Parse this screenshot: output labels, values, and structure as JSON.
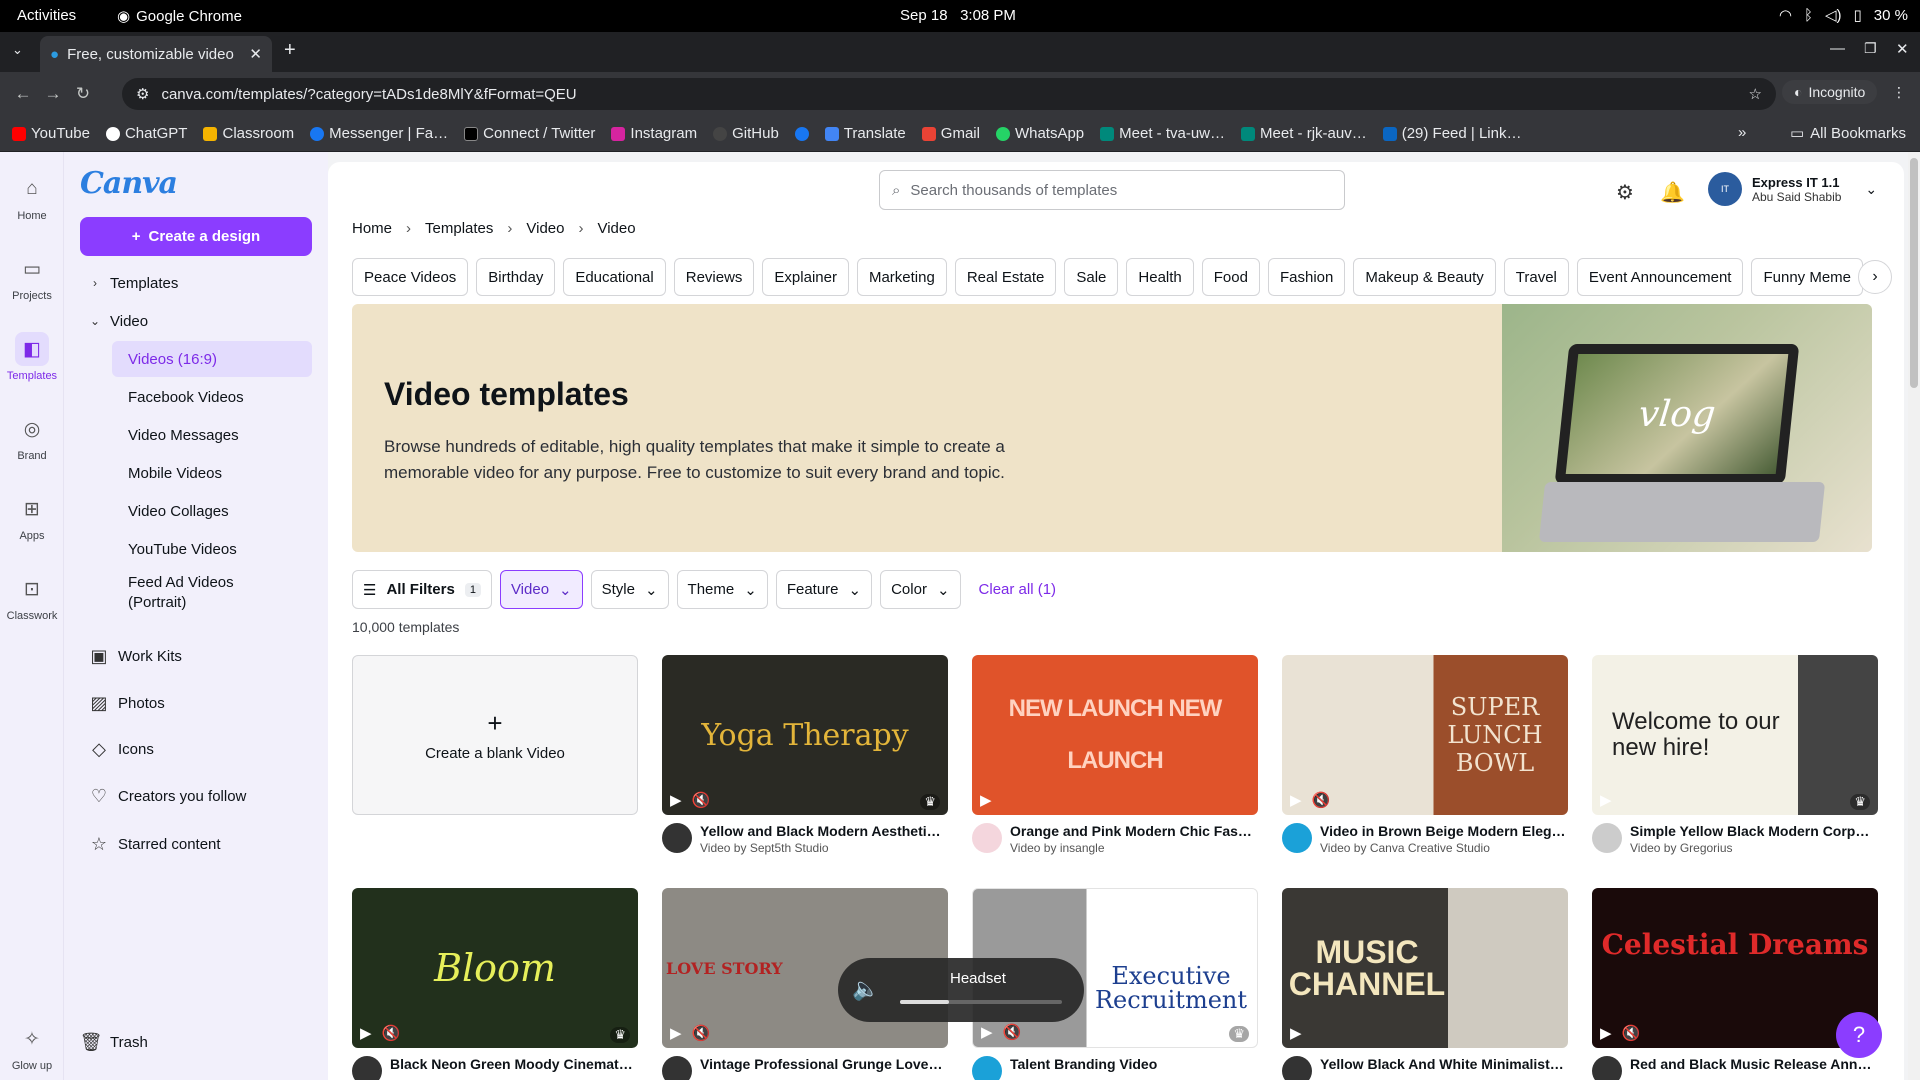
{
  "os": {
    "activities": "Activities",
    "app": "Google Chrome",
    "date": "Sep 18",
    "time": "3:08 PM",
    "battery": "30 %"
  },
  "browser": {
    "tab_title": "Free, customizable video",
    "url": "canva.com/templates/?category=tADs1de8MlY&fFormat=QEU",
    "incognito": "Incognito",
    "bookmarks": [
      "YouTube",
      "ChatGPT",
      "Classroom",
      "Messenger | Fa…",
      "Connect / Twitter",
      "Instagram",
      "GitHub",
      "",
      "Translate",
      "Gmail",
      "WhatsApp",
      "Meet - tva-uw…",
      "Meet - rjk-auv…",
      "(29) Feed | Link…"
    ],
    "all_bookmarks": "All Bookmarks"
  },
  "rail": [
    {
      "label": "Home",
      "icon": "home-icon"
    },
    {
      "label": "Projects",
      "icon": "folder-icon"
    },
    {
      "label": "Templates",
      "icon": "templates-icon"
    },
    {
      "label": "Brand",
      "icon": "brand-icon"
    },
    {
      "label": "Apps",
      "icon": "apps-icon"
    },
    {
      "label": "Classwork",
      "icon": "classwork-icon"
    },
    {
      "label": "Glow up",
      "icon": "sparkle-icon"
    }
  ],
  "sidebar": {
    "logo": "Canva",
    "create": "Create a design",
    "templates": "Templates",
    "video": "Video",
    "video_items": [
      "Videos (16:9)",
      "Facebook Videos",
      "Video Messages",
      "Mobile Videos",
      "Video Collages",
      "YouTube Videos",
      "Feed Ad Videos (Portrait)"
    ],
    "work_kits": "Work Kits",
    "photos": "Photos",
    "icons": "Icons",
    "creators": "Creators you follow",
    "starred": "Starred content",
    "trash": "Trash"
  },
  "header": {
    "search_placeholder": "Search thousands of templates",
    "account_name": "Express IT 1.1",
    "account_user": "Abu Said Shabib"
  },
  "breadcrumb": [
    "Home",
    "Templates",
    "Video",
    "Video"
  ],
  "chips": [
    "Peace Videos",
    "Birthday",
    "Educational",
    "Reviews",
    "Explainer",
    "Marketing",
    "Real Estate",
    "Sale",
    "Health",
    "Food",
    "Fashion",
    "Makeup & Beauty",
    "Travel",
    "Event Announcement",
    "Funny Meme"
  ],
  "hero": {
    "title": "Video templates",
    "desc": "Browse hundreds of editable, high quality templates that make it simple to create a memorable video for any purpose. Free to customize to suit every brand and topic.",
    "image_text": "vlog"
  },
  "filters": {
    "all": "All Filters",
    "all_count": "1",
    "items": [
      "Video",
      "Style",
      "Theme",
      "Feature",
      "Color"
    ],
    "clear": "Clear all (1)"
  },
  "result_count": "10,000 templates",
  "blank_card": "Create a blank Video",
  "cards_row1": [
    {
      "title": "Yellow and Black Modern Aestheti…",
      "by": "Video by Sept5th Studio",
      "thumb": "Yoga Therapy",
      "bg": "#2a2a24",
      "fg": "#e3b53a"
    },
    {
      "title": "Orange and Pink Modern Chic Fas…",
      "by": "Video by insangle",
      "thumb": "NEW LAUNCH NEW LAUNCH",
      "bg": "#e0532a",
      "fg": "#ffd2c0"
    },
    {
      "title": "Video in Brown Beige Modern Eleg…",
      "by": "Video by Canva Creative Studio",
      "thumb": "SUPER LUNCH BOWL",
      "bg": "#9b4e2b",
      "fg": "#f2e3cf"
    },
    {
      "title": "Simple Yellow Black Modern Corp…",
      "by": "Video by Gregorius",
      "thumb": "Welcome to our new hire!",
      "bg": "#f3f1e6",
      "fg": "#222"
    }
  ],
  "cards_row2": [
    {
      "title": "Black Neon Green Moody Cinemat…",
      "thumb": "Bloom",
      "bg": "#22301c",
      "fg": "#e6ef5a"
    },
    {
      "title": "Vintage Professional Grunge Love…",
      "thumb": "LOVE STORY",
      "bg": "#8d8a84",
      "fg": "#b22222"
    },
    {
      "title": "Talent Branding Video",
      "thumb": "Executive Recruitment",
      "bg": "#ffffff",
      "fg": "#1d3f8f"
    },
    {
      "title": "Yellow Black And White Minimalist…",
      "thumb": "MUSIC CHANNEL",
      "bg": "#3a3834",
      "fg": "#f3e6bd"
    },
    {
      "title": "Red and Black Music Release Ann…",
      "thumb": "Celestial Dreams",
      "bg": "#1a0a0a",
      "fg": "#e02a2a"
    }
  ],
  "osd": {
    "label": "Headset",
    "level": 0.3
  },
  "colors": {
    "accent": "#8b3dff",
    "accent_text": "#7d2ae8"
  }
}
